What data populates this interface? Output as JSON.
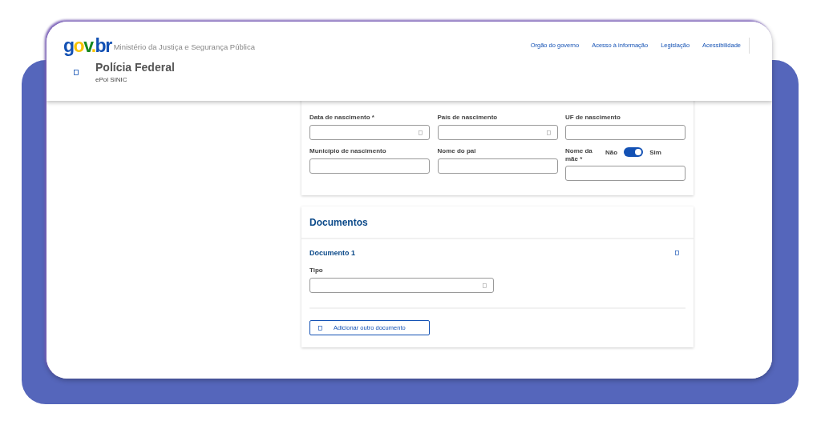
{
  "header": {
    "logo": "gov.br",
    "ministry": "Ministério da Justiça e Segurança Pública",
    "links": [
      "Orgão do governo",
      "Acesso à informação",
      "Legislação",
      "Acessibilidade"
    ],
    "title": "Polícia Federal",
    "subtitle": "ePol SINIC"
  },
  "personal_section": {
    "fields": [
      {
        "label": "Data de nascimento *",
        "kind": "select"
      },
      {
        "label": "País de nascimento",
        "kind": "select"
      },
      {
        "label": "UF de nascimento",
        "kind": "text"
      },
      {
        "label": "Município de nascimento",
        "kind": "text"
      },
      {
        "label": "Nome do pai",
        "kind": "text"
      },
      {
        "label": "Nome da mãe *",
        "kind": "text",
        "toggle": {
          "off_label": "Não",
          "on_label": "Sim",
          "on": true
        }
      }
    ]
  },
  "documents": {
    "title": "Documentos",
    "items": [
      {
        "title": "Documento 1",
        "fields": [
          {
            "label": "Tipo",
            "kind": "select"
          }
        ]
      }
    ],
    "add_button": "Adicionar outro documento"
  }
}
